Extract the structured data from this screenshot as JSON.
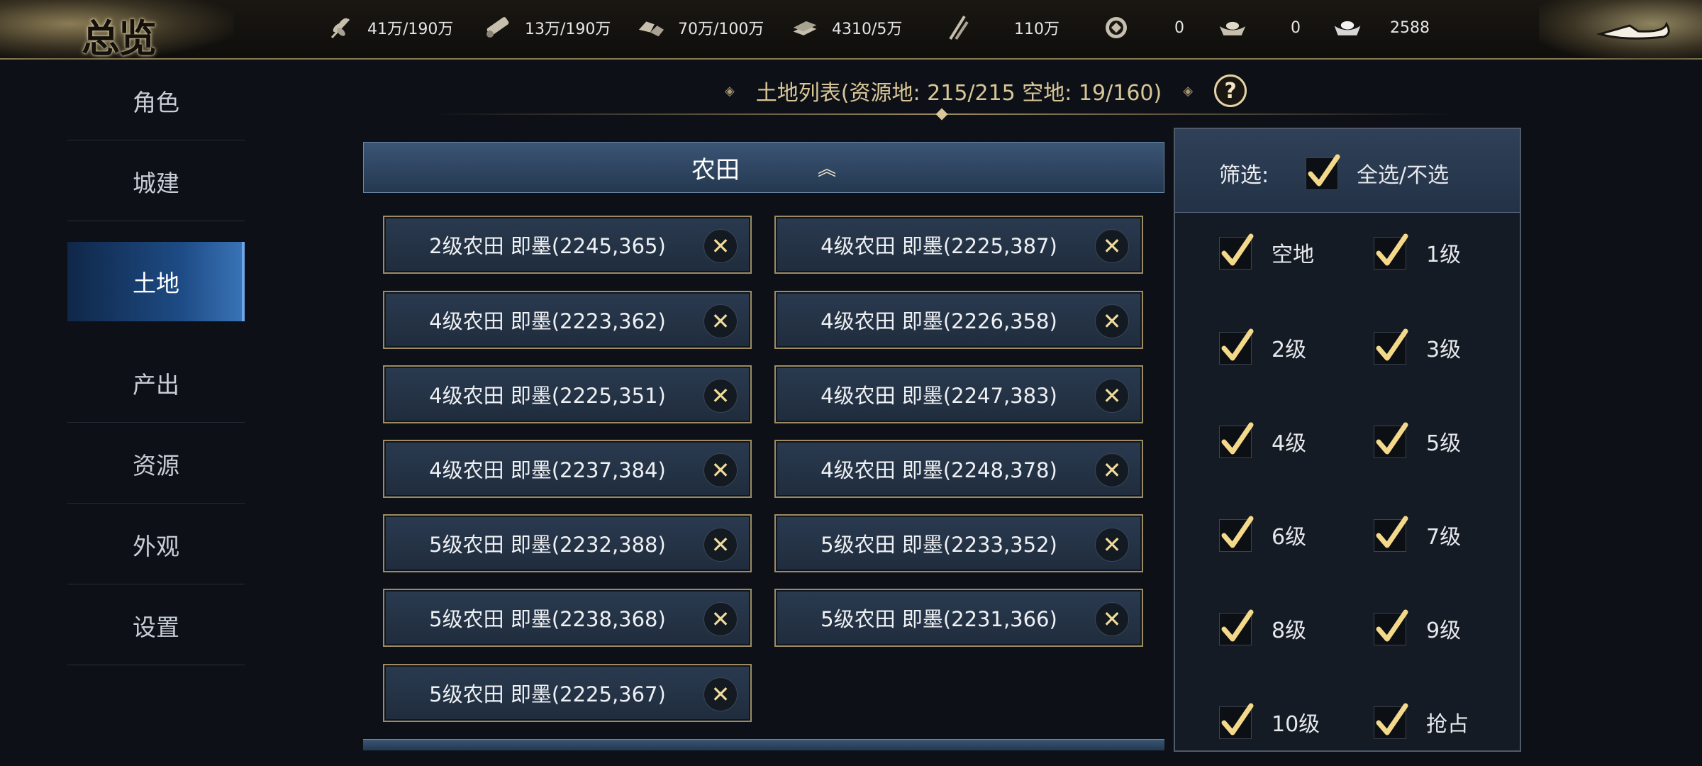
{
  "title_logo": "总览",
  "resources": [
    {
      "icon": "grain-icon",
      "value": "41万/190万"
    },
    {
      "icon": "wood-icon",
      "value": "13万/190万"
    },
    {
      "icon": "stone-icon",
      "value": "70万/100万"
    },
    {
      "icon": "iron-icon",
      "value": "4310/5万"
    },
    {
      "icon": "troops-icon",
      "value": "110万"
    },
    {
      "icon": "coin-icon",
      "value": "0"
    },
    {
      "icon": "gold-ingot-icon",
      "value": "0"
    },
    {
      "icon": "silver-ingot-icon",
      "value": "2588"
    }
  ],
  "sidebar": {
    "items": [
      {
        "label": "角色",
        "active": false
      },
      {
        "label": "城建",
        "active": false
      },
      {
        "label": "土地",
        "active": true
      },
      {
        "label": "产出",
        "active": false
      },
      {
        "label": "资源",
        "active": false
      },
      {
        "label": "外观",
        "active": false
      },
      {
        "label": "设置",
        "active": false
      }
    ]
  },
  "list_header": {
    "title": "土地列表(资源地: 215/215   空地: 19/160)",
    "help": "?"
  },
  "section": {
    "title": "农田",
    "collapse_glyph": "︽"
  },
  "lands": [
    "2级农田 即墨(2245,365)",
    "4级农田 即墨(2225,387)",
    "4级农田 即墨(2223,362)",
    "4级农田 即墨(2226,358)",
    "4级农田 即墨(2225,351)",
    "4级农田 即墨(2247,383)",
    "4级农田 即墨(2237,384)",
    "4级农田 即墨(2248,378)",
    "5级农田 即墨(2232,388)",
    "5级农田 即墨(2233,352)",
    "5级农田 即墨(2238,368)",
    "5级农田 即墨(2231,366)",
    "5级农田 即墨(2225,367)"
  ],
  "remove_glyph": "✕",
  "filter": {
    "label": "筛选:",
    "select_all": "全选/不选",
    "select_all_checked": true,
    "options": [
      {
        "label": "空地",
        "checked": true
      },
      {
        "label": "1级",
        "checked": true
      },
      {
        "label": "2级",
        "checked": true
      },
      {
        "label": "3级",
        "checked": true
      },
      {
        "label": "4级",
        "checked": true
      },
      {
        "label": "5级",
        "checked": true
      },
      {
        "label": "6级",
        "checked": true
      },
      {
        "label": "7级",
        "checked": true
      },
      {
        "label": "8级",
        "checked": true
      },
      {
        "label": "9级",
        "checked": true
      },
      {
        "label": "10级",
        "checked": true
      },
      {
        "label": "抢占",
        "checked": true
      }
    ]
  },
  "colors": {
    "accent_gold": "#d9c697",
    "active_blue": "#1e4c86",
    "check_gold": "#f4d98a"
  }
}
